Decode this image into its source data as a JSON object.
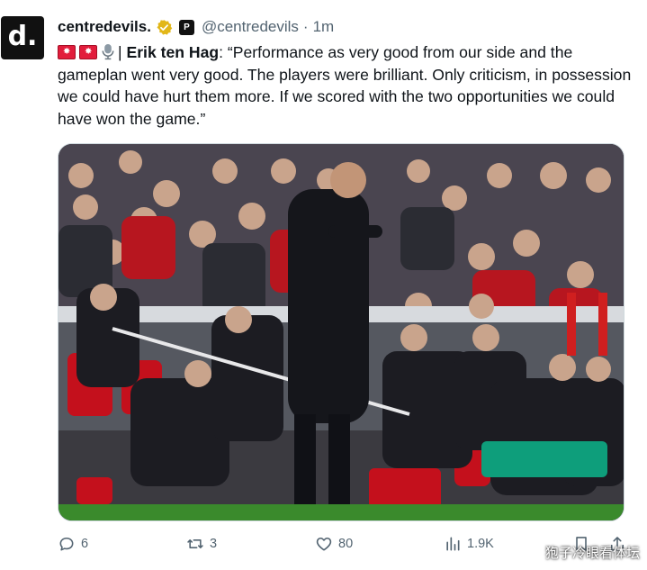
{
  "author": {
    "display_name": "centredevils.",
    "handle": "@centredevils",
    "separator": "·",
    "time": "1m",
    "avatar_glyph": "d."
  },
  "tweet": {
    "speaker": "Erik ten Hag",
    "separator": "|",
    "body": ": “Performance as very good from our side and the gameplan went very good. The players were brilliant. Only criticism, in possession we could have hurt them more. If we scored with the two opportunities we could have won the game.”"
  },
  "actions": {
    "replies": "6",
    "retweets": "3",
    "likes": "80",
    "views": "1.9K"
  },
  "watermark": "狍子冷眼看体坛",
  "colors": {
    "text": "#0f1419",
    "muted": "#536471",
    "verified": "#e2b719",
    "pitch": "#3a8a2c",
    "seat_red": "#c4101c"
  }
}
